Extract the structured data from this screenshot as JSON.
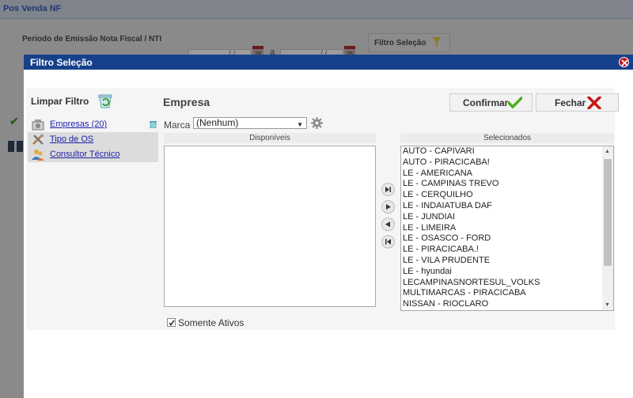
{
  "background": {
    "title": "Pos Venda NF",
    "period_label": "Periodo de Emissão Nota Fiscal / NTI",
    "filter_button_label": "Filtro Seleção",
    "date_placeholder_1": "/ /",
    "date_placeholder_2": "/ /",
    "date_separator": "a",
    "calendar_day": "28"
  },
  "modal": {
    "title": "Filtro Seleção",
    "clear_filter_label": "Limpar Filtro",
    "section_title": "Empresa",
    "confirm_label": "Confirmar",
    "close_label": "Fechar",
    "left_items": [
      {
        "label": "Empresas (20)",
        "icon": "building-icon"
      },
      {
        "label": "Tipo de OS",
        "icon": "tools-icon"
      },
      {
        "label": "Consultor Técnico",
        "icon": "people-icon"
      }
    ],
    "brand_label": "Marca",
    "brand_value": "(Nenhum)",
    "available_header": "Disponíveis",
    "selected_header": "Selecionados",
    "available_items": [],
    "selected_items": [
      "AUTO  - CAPIVARI",
      "AUTO  - PIRACICABA!",
      "LE - AMERICANA",
      "LE - CAMPINAS TREVO",
      "LE - CERQUILHO",
      "LE - INDAIATUBA DAF",
      "LE - JUNDIAI",
      "LE - LIMEIRA",
      "LE - OSASCO - FORD",
      "LE - PIRACICABA.!",
      "LE - VILA PRUDENTE",
      "LE - hyundai",
      "LECAMPINASNORTESUL_VOLKS",
      "MULTIMARCAS - PIRACICABA",
      "NISSAN  - RIOCLARO"
    ],
    "only_active_label": "Somente Ativos",
    "only_active_checked": true
  },
  "colors": {
    "header_blue": "#16418a",
    "link_blue": "#1d1fa8",
    "confirm_green": "#4caf20",
    "close_red": "#c7151b"
  }
}
